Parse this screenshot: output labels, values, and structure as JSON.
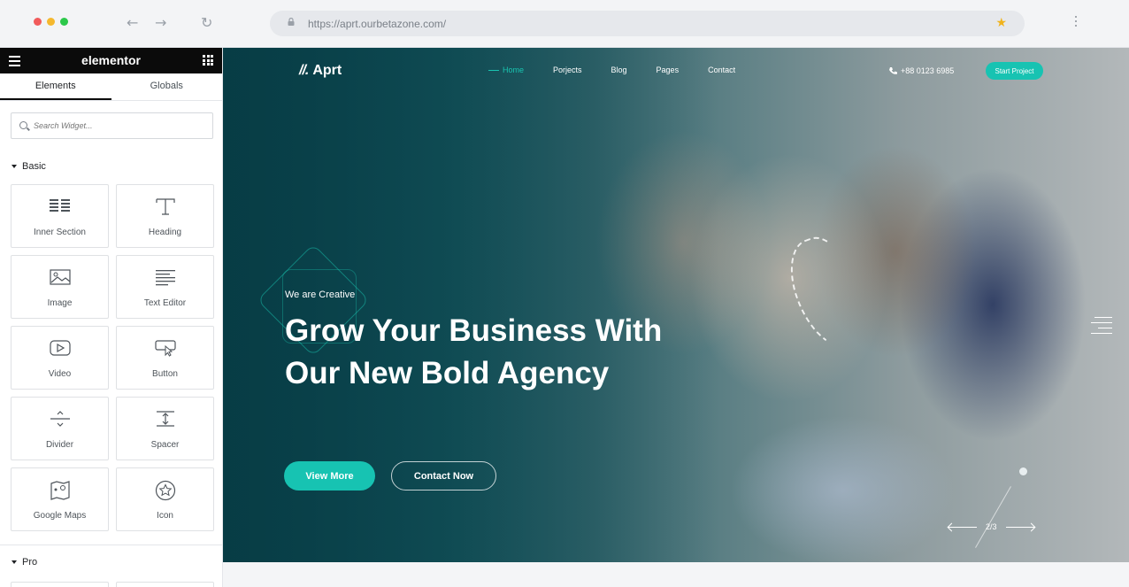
{
  "browser": {
    "url": "https://aprt.ourbetazone.com/",
    "traffic_colors": [
      "#f15b5b",
      "#f5b82e",
      "#2cc84a"
    ]
  },
  "panel": {
    "brand": "elementor",
    "tabs": [
      "Elements",
      "Globals"
    ],
    "search_placeholder": "Search Widget...",
    "basic_title": "Basic",
    "pro_title": "Pro",
    "widgets": [
      {
        "label": "Inner Section",
        "icon": "inner-section-icon"
      },
      {
        "label": "Heading",
        "icon": "heading-icon"
      },
      {
        "label": "Image",
        "icon": "image-icon"
      },
      {
        "label": "Text Editor",
        "icon": "text-editor-icon"
      },
      {
        "label": "Video",
        "icon": "video-icon"
      },
      {
        "label": "Button",
        "icon": "button-icon"
      },
      {
        "label": "Divider",
        "icon": "divider-icon"
      },
      {
        "label": "Spacer",
        "icon": "spacer-icon"
      },
      {
        "label": "Google Maps",
        "icon": "google-maps-icon"
      },
      {
        "label": "Icon",
        "icon": "star-icon"
      }
    ]
  },
  "site": {
    "logo_mark": "//.",
    "logo_text": "Aprt",
    "nav": [
      "Home",
      "Porjects",
      "Blog",
      "Pages",
      "Contact"
    ],
    "phone": "+88 0123 6985",
    "cta": "Start Project",
    "eyebrow": "We are Creative",
    "headline": "Grow Your Business With Our New Bold Agency",
    "btn_primary": "View More",
    "btn_secondary": "Contact Now",
    "slide_counter": "2/3",
    "accent": "#17c3b2"
  }
}
